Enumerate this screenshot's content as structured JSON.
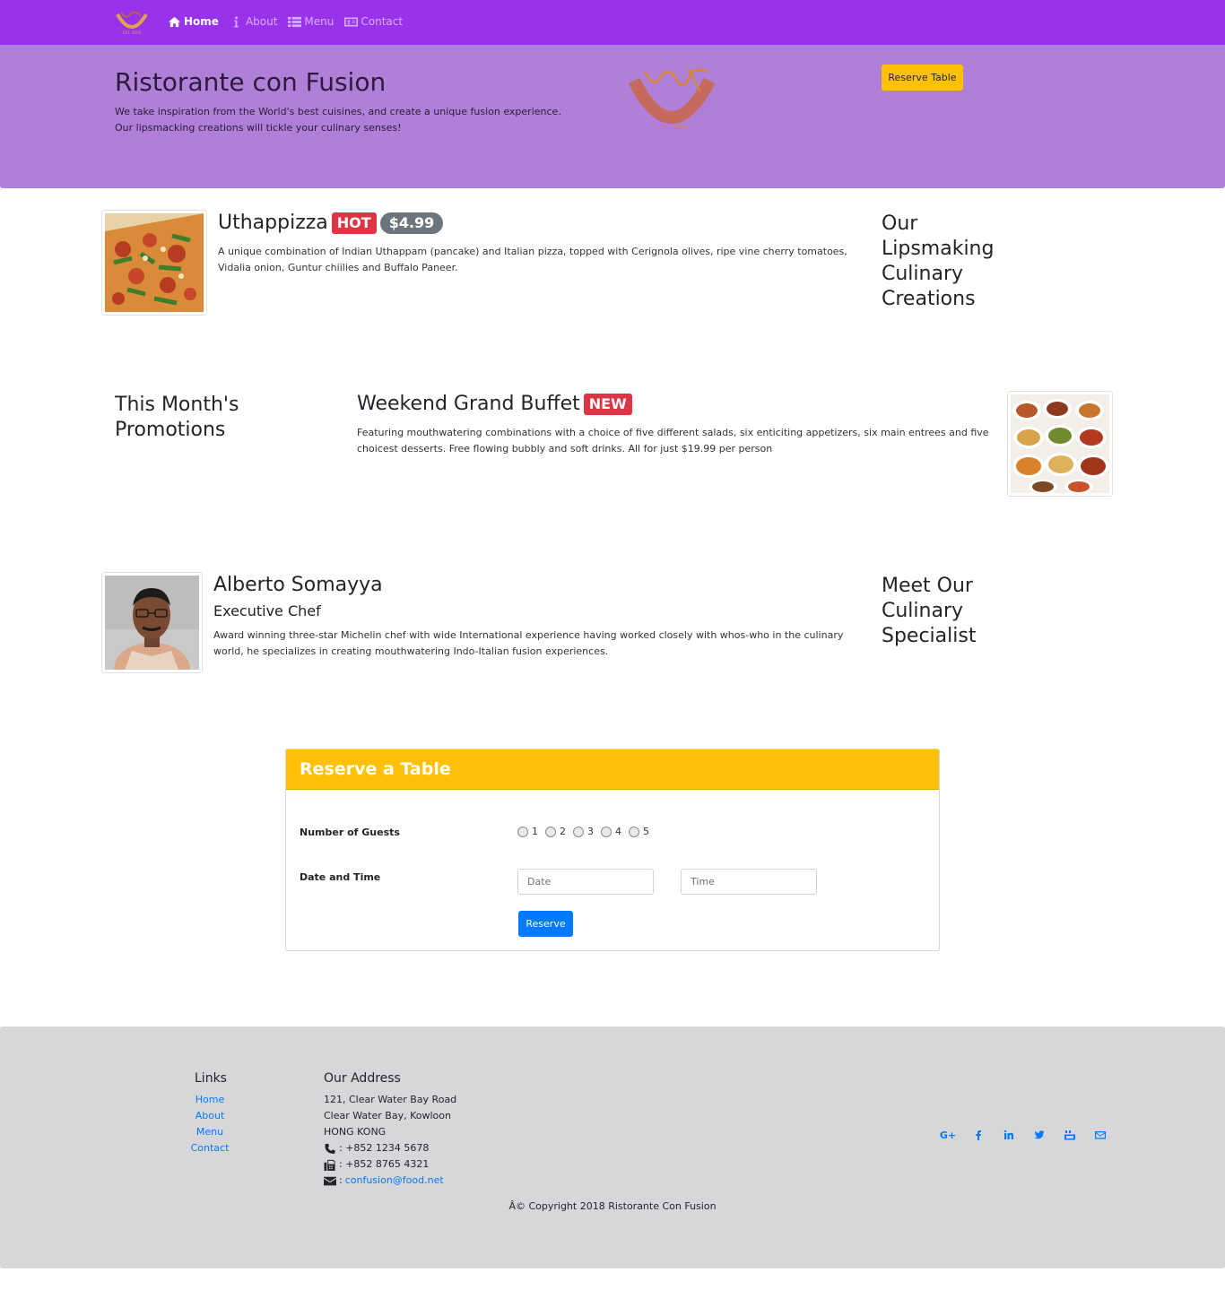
{
  "nav": {
    "items": [
      {
        "label": "Home",
        "icon": "home-icon"
      },
      {
        "label": "About",
        "icon": "info-icon"
      },
      {
        "label": "Menu",
        "icon": "list-icon"
      },
      {
        "label": "Contact",
        "icon": "address-card-icon"
      }
    ],
    "active": "Home",
    "color": "#9932eb"
  },
  "jumbotron": {
    "title": "Ristorante con Fusion",
    "text": "We take inspiration from the World's best cuisines, and create a unique fusion experience. Our lipsmacking creations will tickle your culinary senses!",
    "reserve_button": "Reserve Table",
    "logo_text": "Ristorante con Fusion",
    "logo_est": "Est. 2013",
    "color": "#b07fd8"
  },
  "dish": {
    "name": "Uthappizza",
    "badge": "HOT",
    "price": "$4.99",
    "description": "A unique combination of Indian Uthappam (pancake) and Italian pizza, topped with Cerignola olives, ripe vine cherry tomatoes, Vidalia onion, Guntur chiilies and Buffalo Paneer.",
    "side_heading": "Our Lipsmaking Culinary Creations"
  },
  "promotion": {
    "side_heading": "This Month's Promotions",
    "name": "Weekend Grand Buffet",
    "badge": "NEW",
    "description": "Featuring mouthwatering combinations with a choice of five different salads, six enticiting appetizers, six main entrees and five choicest desserts. Free flowing bubbly and soft drinks. All for just $19.99 per person"
  },
  "leader": {
    "name": "Alberto Somayya",
    "designation": "Executive Chef",
    "description": "Award winning three-star Michelin chef with wide International experience having worked closely with whos-who in the culinary world, he specializes in creating mouthwatering Indo-Italian fusion experiences.",
    "side_heading": "Meet Our Culinary Specialist"
  },
  "reserve": {
    "title": "Reserve a Table",
    "guests_label": "Number of Guests",
    "guests_options": [
      "1",
      "2",
      "3",
      "4",
      "5"
    ],
    "datetime_label": "Date and Time",
    "date_placeholder": "Date",
    "time_placeholder": "Time",
    "submit": "Reserve",
    "header_color": "#ffc107"
  },
  "footer": {
    "links_heading": "Links",
    "links": [
      "Home",
      "About",
      "Menu",
      "Contact"
    ],
    "address_heading": "Our Address",
    "address_lines": [
      "121, Clear Water Bay Road",
      "Clear Water Bay, Kowloon",
      "HONG KONG"
    ],
    "phone": ": +852 1234 5678",
    "fax": ": +852 8765 4321",
    "email_prefix": ": ",
    "email": "confusion@food.net",
    "social_icons": [
      "google-plus-icon",
      "facebook-icon",
      "linkedin-icon",
      "twitter-icon",
      "youtube-icon",
      "envelope-icon"
    ],
    "copyright": "Â© Copyright 2018 Ristorante Con Fusion"
  }
}
